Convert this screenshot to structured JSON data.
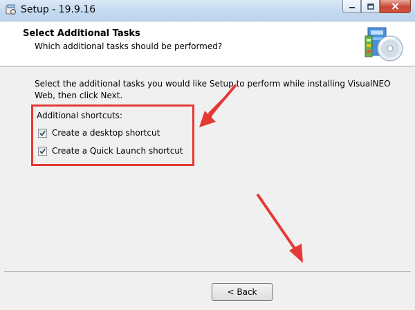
{
  "window": {
    "title": "Setup - 19.9.16",
    "controls": {
      "minimize_icon": "minimize-icon",
      "maximize_icon": "maximize-icon",
      "close_icon": "close-icon"
    }
  },
  "header": {
    "title": "Select Additional Tasks",
    "subtitle": "Which additional tasks should be performed?",
    "logo_icon": "setup-cd-icon"
  },
  "body": {
    "instruction": "Select the additional tasks you would like Setup to perform while installing VisualNEO Web, then click Next.",
    "group_label": "Additional shortcuts:",
    "tasks": [
      {
        "label": "Create a desktop shortcut",
        "checked": true
      },
      {
        "label": "Create a Quick Launch shortcut",
        "checked": true
      }
    ]
  },
  "footer": {
    "back_label": "< Back"
  },
  "colors": {
    "annotation_red": "#e53935",
    "title_bar": "#c4daf0",
    "header_bg": "#ffffff",
    "window_bg": "#f0f0f0"
  }
}
